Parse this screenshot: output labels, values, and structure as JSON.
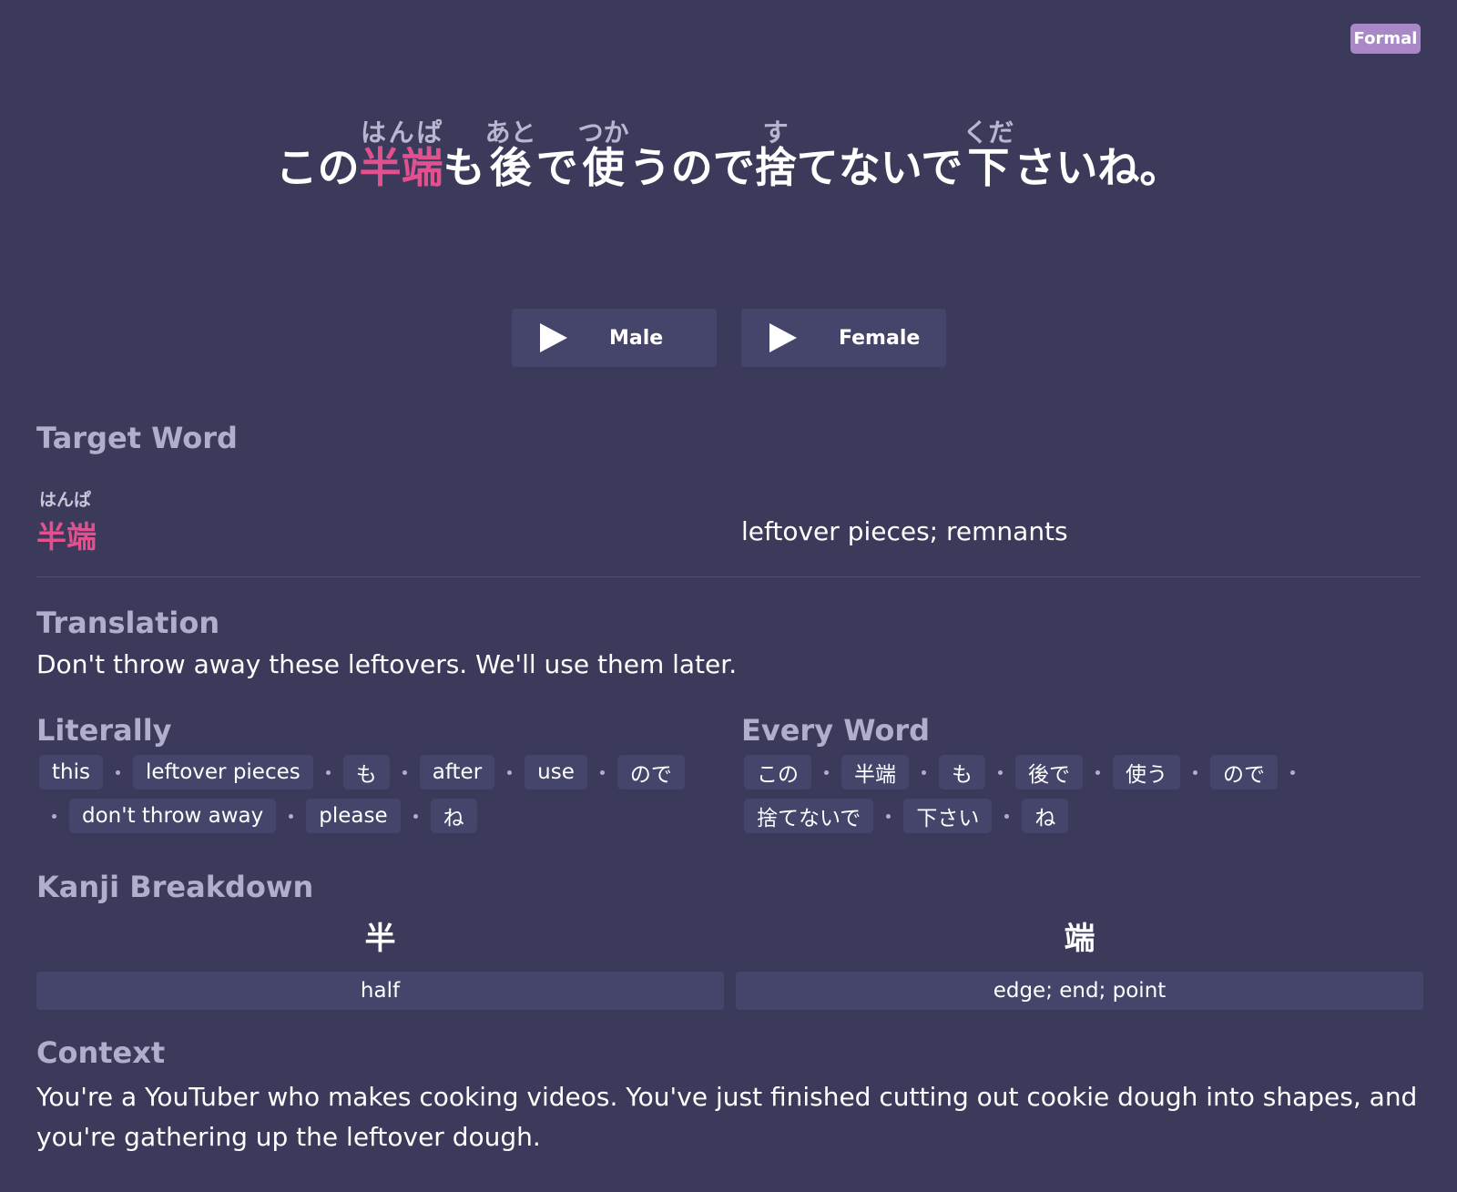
{
  "badge": "Formal",
  "sentence": [
    {
      "text": "この",
      "rt": "",
      "hl": false
    },
    {
      "text": "半端",
      "rt": "はんぱ",
      "hl": true
    },
    {
      "text": "も",
      "rt": "",
      "hl": false
    },
    {
      "text": "後",
      "rt": "あと",
      "hl": false
    },
    {
      "text": "で",
      "rt": "",
      "hl": false
    },
    {
      "text": "使",
      "rt": "つか",
      "hl": false
    },
    {
      "text": "うので",
      "rt": "",
      "hl": false
    },
    {
      "text": "捨",
      "rt": "す",
      "hl": false
    },
    {
      "text": "てないで",
      "rt": "",
      "hl": false
    },
    {
      "text": "下",
      "rt": "くだ",
      "hl": false
    },
    {
      "text": "さいね。",
      "rt": "",
      "hl": false
    }
  ],
  "buttons": {
    "male": "Male",
    "female": "Female"
  },
  "target_word": {
    "title": "Target Word",
    "reading": "はんぱ",
    "word": "半端",
    "meaning": "leftover pieces; remnants"
  },
  "translation": {
    "title": "Translation",
    "text": "Don't throw away these leftovers. We'll use them later."
  },
  "literally": {
    "title": "Literally",
    "chips": [
      "this",
      "leftover pieces",
      "も",
      "after",
      "use",
      "ので",
      "don't throw away",
      "please",
      "ね"
    ]
  },
  "every_word": {
    "title": "Every Word",
    "chips": [
      "この",
      "半端",
      "も",
      "後で",
      "使う",
      "ので",
      "捨てないで",
      "下さい",
      "ね"
    ]
  },
  "kanji_breakdown": {
    "title": "Kanji Breakdown",
    "items": [
      {
        "kanji": "半",
        "meaning": "half"
      },
      {
        "kanji": "端",
        "meaning": "edge; end; point"
      }
    ]
  },
  "context": {
    "title": "Context",
    "text": "You're a YouTuber who makes cooking videos. You've just finished cutting out cookie dough into shapes, and you're gathering up the leftover dough."
  },
  "colors": {
    "background": "#3b3a5a",
    "accent": "#e2508e",
    "badge": "#a888c6",
    "chip": "#45446a"
  }
}
